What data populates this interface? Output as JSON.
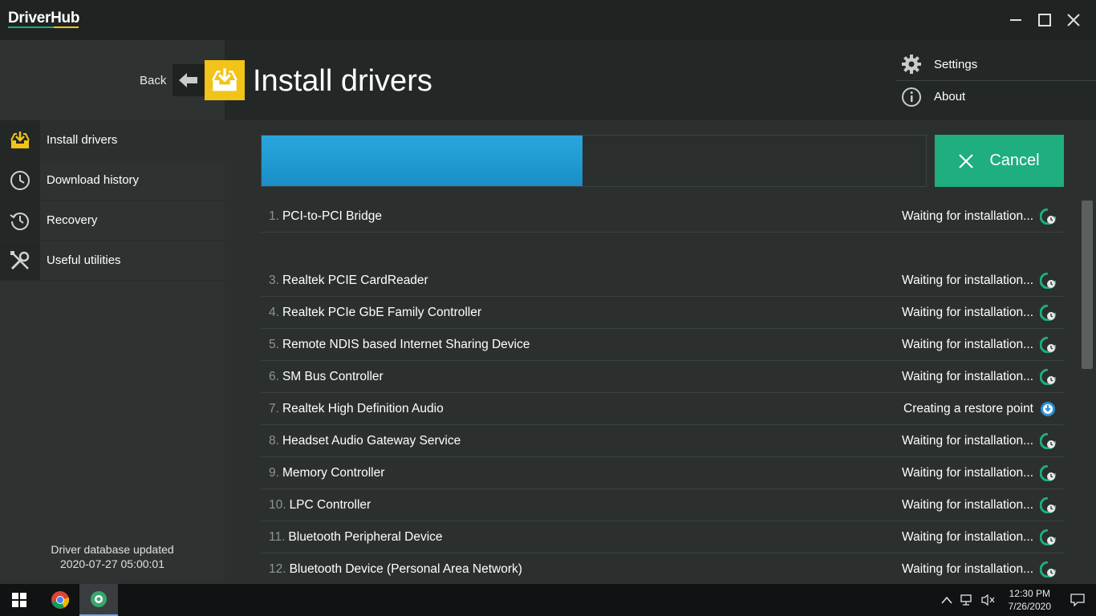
{
  "app": {
    "title": "DriverHub"
  },
  "window": {
    "minimize": "—",
    "maximize": "☐",
    "close": "✕"
  },
  "sidebar": {
    "back_label": "Back",
    "items": [
      {
        "label": "Install drivers",
        "icon": "install-icon",
        "active": true
      },
      {
        "label": "Download history",
        "icon": "clock-icon"
      },
      {
        "label": "Recovery",
        "icon": "history-icon"
      },
      {
        "label": "Useful utilities",
        "icon": "tools-icon"
      }
    ],
    "db_info": {
      "line1": "Driver database updated",
      "line2": "2020-07-27 05:00:01"
    }
  },
  "header": {
    "title": "Install drivers",
    "menu": [
      {
        "label": "Settings",
        "icon": "gear-icon"
      },
      {
        "label": "About",
        "icon": "info-icon"
      }
    ]
  },
  "progress": {
    "percent": 48.3
  },
  "cancel_label": "Cancel",
  "drivers": [
    {
      "num": "1.",
      "name": "PCI-to-PCI Bridge",
      "status": "Waiting for installation...",
      "state": "waiting"
    },
    {
      "num": "",
      "name": "",
      "status": "",
      "state": "empty"
    },
    {
      "num": "3.",
      "name": "Realtek PCIE CardReader",
      "status": "Waiting for installation...",
      "state": "waiting"
    },
    {
      "num": "4.",
      "name": "Realtek PCIe GbE Family Controller",
      "status": "Waiting for installation...",
      "state": "waiting"
    },
    {
      "num": "5.",
      "name": "Remote NDIS based Internet Sharing Device",
      "status": "Waiting for installation...",
      "state": "waiting"
    },
    {
      "num": "6.",
      "name": "SM Bus Controller",
      "status": "Waiting for installation...",
      "state": "waiting"
    },
    {
      "num": "7.",
      "name": "Realtek High Definition Audio",
      "status": "Creating a restore point",
      "state": "active"
    },
    {
      "num": "8.",
      "name": "Headset Audio Gateway Service",
      "status": "Waiting for installation...",
      "state": "waiting"
    },
    {
      "num": "9.",
      "name": "Memory Controller",
      "status": "Waiting for installation...",
      "state": "waiting"
    },
    {
      "num": "10.",
      "name": "LPC Controller",
      "status": "Waiting for installation...",
      "state": "waiting"
    },
    {
      "num": "11.",
      "name": "Bluetooth Peripheral Device",
      "status": "Waiting for installation...",
      "state": "waiting"
    },
    {
      "num": "12.",
      "name": "Bluetooth Device (Personal Area Network)",
      "status": "Waiting for installation...",
      "state": "waiting"
    }
  ],
  "taskbar": {
    "apps": [
      "chrome-icon",
      "driverhub-icon"
    ],
    "time": "12:30 PM",
    "date": "7/26/2020"
  },
  "colors": {
    "accent_green": "#1eae7f",
    "accent_yellow": "#f2c318",
    "progress_blue": "#1b8ec6"
  }
}
